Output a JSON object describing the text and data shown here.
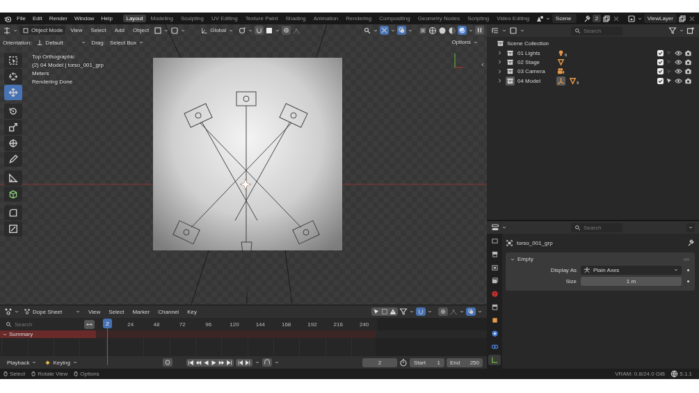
{
  "top_bar": {
    "menus": [
      "File",
      "Edit",
      "Render",
      "Window",
      "Help"
    ],
    "workspaces": [
      {
        "label": "Layout",
        "selected": true
      },
      {
        "label": "Modeling",
        "selected": false
      },
      {
        "label": "Sculpting",
        "selected": false
      },
      {
        "label": "UV Editing",
        "selected": false
      },
      {
        "label": "Texture Paint",
        "selected": false
      },
      {
        "label": "Shading",
        "selected": false
      },
      {
        "label": "Animation",
        "selected": false
      },
      {
        "label": "Rendering",
        "selected": false
      },
      {
        "label": "Compositing",
        "selected": false
      },
      {
        "label": "Geometry Nodes",
        "selected": false
      },
      {
        "label": "Scripting",
        "selected": false
      },
      {
        "label": "Video Editing",
        "selected": false
      }
    ],
    "scene": "Scene",
    "view_layer_users": "2",
    "view_layer": "ViewLayer"
  },
  "viewport": {
    "mode": "Object Mode",
    "menus": [
      "View",
      "Select",
      "Add",
      "Object"
    ],
    "transform_orientation": "Global",
    "orientation_label": "Orientation:",
    "orientation": "Default",
    "drag_label": "Drag:",
    "drag": "Select Box",
    "options": "Options",
    "info": [
      "Top Orthographic",
      "(2) 04 Model | torso_001_grp",
      "Meters",
      "Rendering Done"
    ],
    "tools": [
      {
        "kind": "select",
        "selected": false
      },
      {
        "kind": "cursor",
        "selected": false
      },
      {
        "kind": "move",
        "selected": true
      },
      {
        "kind": "rotate",
        "selected": false
      },
      {
        "kind": "scale",
        "selected": false
      },
      {
        "kind": "transform",
        "selected": false
      },
      {
        "kind": "annotate",
        "selected": false
      },
      {
        "kind": "measure",
        "selected": false
      },
      {
        "kind": "add-cube",
        "selected": false
      },
      {
        "kind": "bevel",
        "selected": false
      },
      {
        "kind": "inset",
        "selected": false
      }
    ]
  },
  "outliner": {
    "search_placeholder": "Search",
    "root": "Scene Collection",
    "collections": [
      {
        "name": "01 Lights",
        "checked": true,
        "selected": false,
        "contents": [
          {
            "kind": "light",
            "count": "6",
            "selected": false
          }
        ]
      },
      {
        "name": "02 Stage",
        "checked": true,
        "selected": false,
        "contents": [
          {
            "kind": "mesh",
            "selected": false
          }
        ]
      },
      {
        "name": "03 Camera",
        "checked": true,
        "selected": false,
        "contents": [
          {
            "kind": "camera",
            "selected": false
          }
        ]
      },
      {
        "name": "04 Model",
        "checked": true,
        "selected": true,
        "contents": [
          {
            "kind": "empty",
            "selected": true
          },
          {
            "kind": "mesh",
            "count": "9",
            "selected": false
          }
        ]
      }
    ]
  },
  "properties": {
    "search_placeholder": "Search",
    "object_name": "torso_001_grp",
    "tabs": [
      {
        "kind": "tool",
        "selected": false
      },
      {
        "kind": "render",
        "selected": false
      },
      {
        "kind": "output",
        "selected": false
      },
      {
        "kind": "view-layer",
        "selected": false
      },
      {
        "kind": "world",
        "selected": false
      },
      {
        "kind": "collection",
        "selected": false
      },
      {
        "kind": "object",
        "selected": false
      },
      {
        "kind": "physics",
        "selected": false
      },
      {
        "kind": "constraint",
        "selected": false
      },
      {
        "kind": "data",
        "selected": true
      }
    ],
    "panel": {
      "title": "Empty",
      "expanded": true
    },
    "fields": [
      {
        "kind": "dropdown",
        "label": "Display As",
        "value": "Plain Axes"
      },
      {
        "kind": "number",
        "label": "Size",
        "value": "1 m"
      }
    ]
  },
  "dope_sheet": {
    "mode": "Dope Sheet",
    "menus": [
      "View",
      "Select",
      "Marker",
      "Channel",
      "Key"
    ],
    "search_placeholder": "Search",
    "current_frame": "2",
    "ticks": [
      "24",
      "48",
      "72",
      "96",
      "120",
      "144",
      "168",
      "192",
      "216",
      "240"
    ],
    "channels": [
      {
        "name": "Summary",
        "expanded": true
      }
    ]
  },
  "playback": {
    "menus": [
      "Playback",
      "Keying"
    ],
    "frame": "2",
    "start_label": "Start",
    "start": "1",
    "end_label": "End",
    "end": "250"
  },
  "status_bar": {
    "hints": [
      "Select",
      "Rotate View",
      "Options"
    ],
    "vram": "VRAM: 0.8/24.0 GiB",
    "version": "5.1.1"
  }
}
